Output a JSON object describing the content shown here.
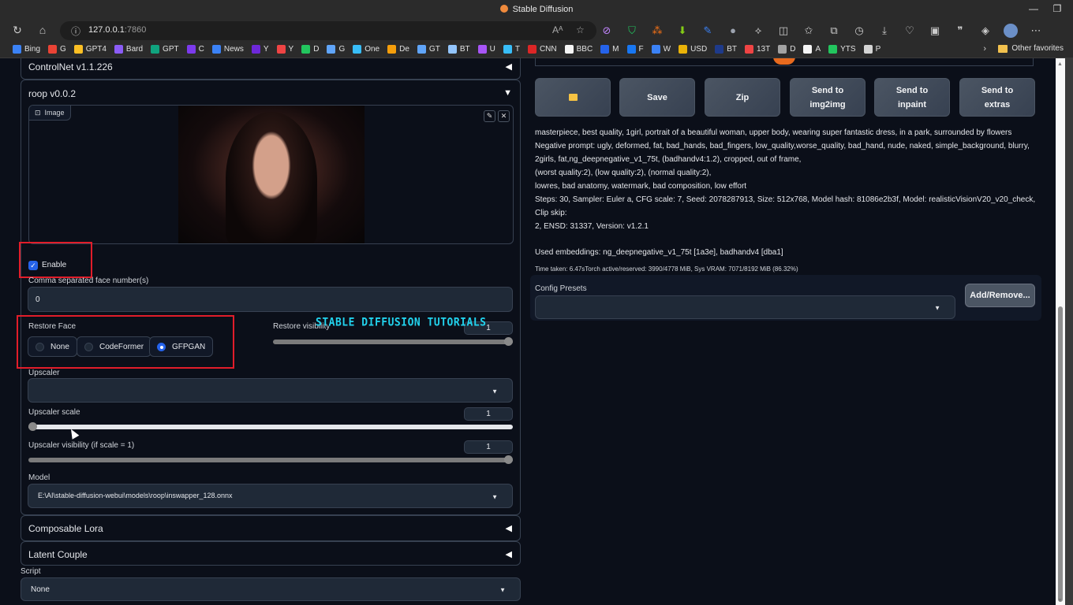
{
  "browser": {
    "window_title": "Stable Diffusion",
    "url_host": "127.0.0.1",
    "url_port": ":7860",
    "bookmarks": [
      {
        "label": "Bing",
        "color": "#3b82f6"
      },
      {
        "label": "G",
        "color": "#ea4335"
      },
      {
        "label": "GPT4",
        "color": "#fbbf24"
      },
      {
        "label": "Bard",
        "color": "#8b5cf6"
      },
      {
        "label": "GPT",
        "color": "#10a37f"
      },
      {
        "label": "C",
        "color": "#7c3aed"
      },
      {
        "label": "News",
        "color": "#3b82f6"
      },
      {
        "label": "Y",
        "color": "#6d28d9"
      },
      {
        "label": "Y",
        "color": "#ef4444"
      },
      {
        "label": "D",
        "color": "#22c55e"
      },
      {
        "label": "G",
        "color": "#60a5fa"
      },
      {
        "label": "One",
        "color": "#38bdf8"
      },
      {
        "label": "De",
        "color": "#f59e0b"
      },
      {
        "label": "GT",
        "color": "#60a5fa"
      },
      {
        "label": "BT",
        "color": "#93c5fd"
      },
      {
        "label": "U",
        "color": "#a855f7"
      },
      {
        "label": "T",
        "color": "#38bdf8"
      },
      {
        "label": "CNN",
        "color": "#dc2626"
      },
      {
        "label": "BBC",
        "color": "#f5f5f5"
      },
      {
        "label": "M",
        "color": "#2563eb"
      },
      {
        "label": "F",
        "color": "#1877f2"
      },
      {
        "label": "W",
        "color": "#3b82f6"
      },
      {
        "label": "USD",
        "color": "#eab308"
      },
      {
        "label": "BT",
        "color": "#1e3a8a"
      },
      {
        "label": "13T",
        "color": "#ef4444"
      },
      {
        "label": "D",
        "color": "#a3a3a3"
      },
      {
        "label": "A",
        "color": "#f5f5f5"
      },
      {
        "label": "YTS",
        "color": "#22c55e"
      },
      {
        "label": "P",
        "color": "#d4d4d4"
      }
    ],
    "other_favorites": "Other favorites"
  },
  "left": {
    "controlnet_title": "ControlNet v1.1.226",
    "roop": {
      "title": "roop v0.0.2",
      "image_label": "Image",
      "enable_label": "Enable",
      "enable_checked": true,
      "face_numbers_label": "Comma separated face number(s)",
      "face_numbers_value": "0",
      "restore_face_label": "Restore Face",
      "restore_face_options": [
        "None",
        "CodeFormer",
        "GFPGAN"
      ],
      "restore_face_selected": "GFPGAN",
      "restore_visibility_label": "Restore visibility",
      "restore_visibility_value": "1",
      "upscaler_label": "Upscaler",
      "upscaler_value": "",
      "upscaler_scale_label": "Upscaler scale",
      "upscaler_scale_value": "1",
      "upscaler_visibility_label": "Upscaler visibility (if scale = 1)",
      "upscaler_visibility_value": "1",
      "model_label": "Model",
      "model_value": "E:\\AI\\stable-diffusion-webui\\models\\roop\\inswapper_128.onnx"
    },
    "composable_lora_title": "Composable Lora",
    "latent_couple_title": "Latent Couple",
    "script_label": "Script",
    "script_value": "None"
  },
  "watermark": "STABLE DIFFUSION TUTORIALS",
  "right": {
    "buttons": [
      {
        "label": "",
        "icon": "folder-icon"
      },
      {
        "label": "Save"
      },
      {
        "label": "Zip"
      },
      {
        "label": "Send to img2img"
      },
      {
        "label": "Send to inpaint"
      },
      {
        "label": "Send to extras"
      }
    ],
    "info_lines": [
      "masterpiece, best quality, 1girl, portrait of a beautiful woman, upper body, wearing super fantastic dress, in a park, surrounded by flowers",
      "Negative prompt: ugly, deformed, fat, bad_hands, bad_fingers, low_quality,worse_quality, bad_hand, nude, naked, simple_background, blurry,",
      "2girls, fat,ng_deepnegative_v1_75t, (badhandv4:1.2), cropped, out of frame,",
      "(worst quality:2), (low quality:2), (normal quality:2),",
      "lowres, bad anatomy, watermark, bad composition, low effort",
      "Steps: 30, Sampler: Euler a, CFG scale: 7, Seed: 2078287913, Size: 512x768, Model hash: 81086e2b3f, Model: realisticVisionV20_v20_check, Clip skip:",
      "2, ENSD: 31337, Version: v1.2.1"
    ],
    "embeddings": "Used embeddings: ng_deepnegative_v1_75t [1a3e], badhandv4 [dba1]",
    "time_taken": "Time taken: 6.47sTorch active/reserved: 3990/4778 MiB, Sys VRAM: 7071/8192 MiB (86.32%)",
    "config_presets_label": "Config Presets",
    "config_presets_value": "",
    "add_remove_label": "Add/Remove..."
  },
  "sliders": {
    "restore_visibility_fraction": 1.0,
    "upscaler_scale_fraction": 0.0,
    "upscaler_visibility_fraction": 1.0
  }
}
